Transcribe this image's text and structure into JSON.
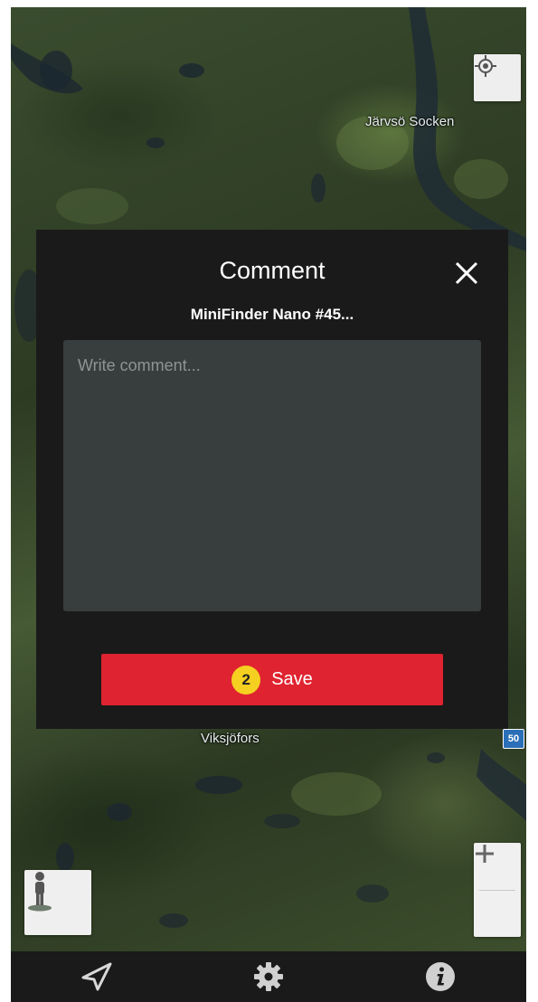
{
  "map": {
    "labels": {
      "north": "Järvsö Socken",
      "south": "Viksjöfors"
    },
    "road_number": "50",
    "locate_icon": "crosshair-icon",
    "zoom": {
      "in_label": "+",
      "out_label": "−"
    },
    "streetview_icon": "pegman-icon"
  },
  "dialog": {
    "title": "Comment",
    "close_icon": "close-icon",
    "device_name": "MiniFinder Nano #45...",
    "comment_placeholder": "Write comment...",
    "comment_value": "",
    "step_number": "2",
    "save_label": "Save"
  },
  "nav": {
    "items": [
      {
        "icon": "navigation-arrow-icon"
      },
      {
        "icon": "gear-icon"
      },
      {
        "icon": "info-icon"
      }
    ]
  },
  "colors": {
    "dialog_bg": "#1b1a1a",
    "textarea_bg": "#383d3d",
    "save_button": "#e02330",
    "step_badge": "#f5d020",
    "nav_bg": "#1a1a1a"
  }
}
